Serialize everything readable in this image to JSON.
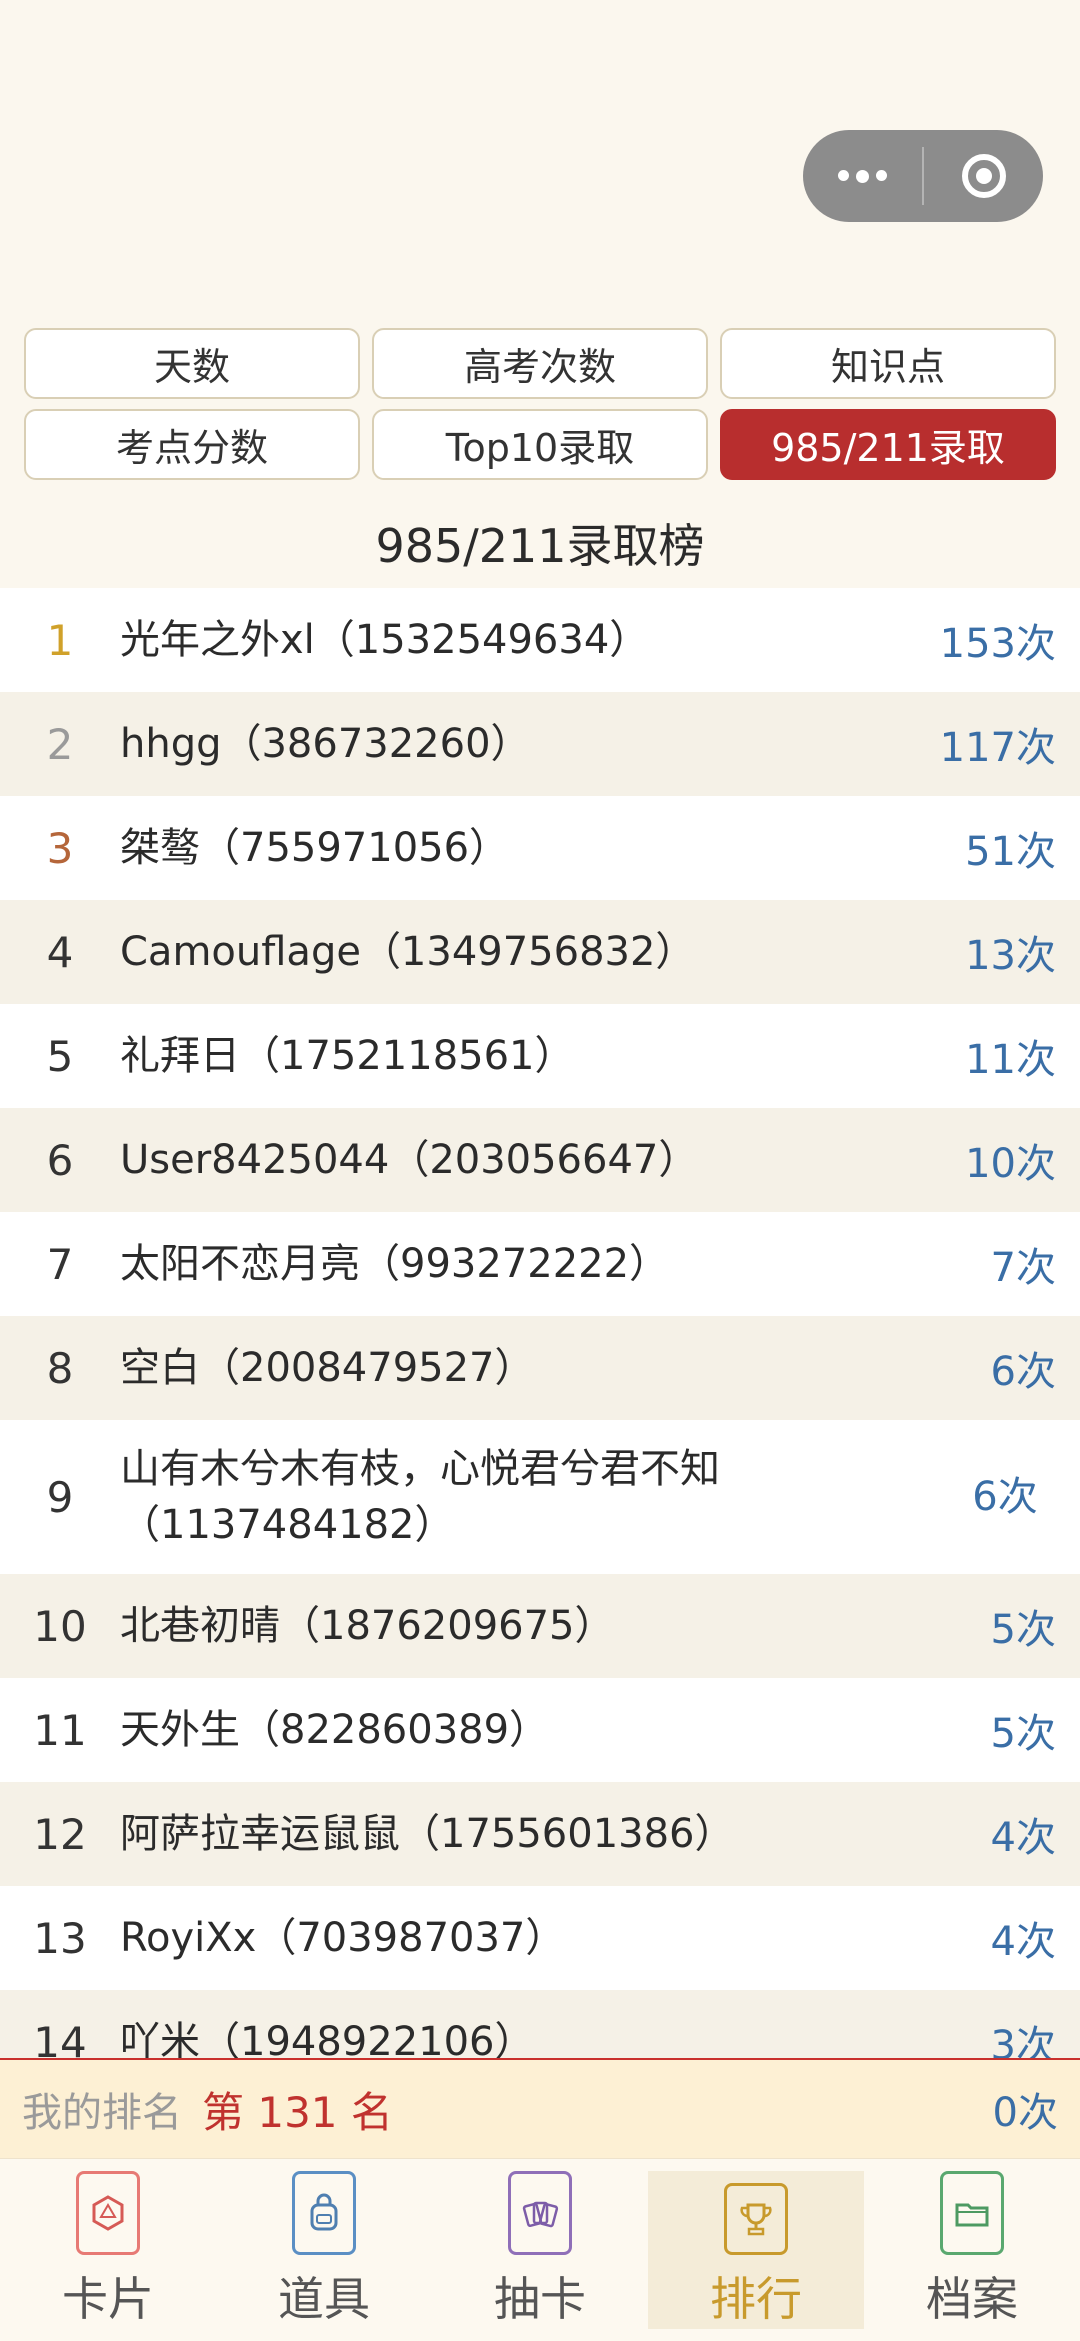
{
  "tabs": [
    {
      "label": "天数"
    },
    {
      "label": "高考次数"
    },
    {
      "label": "知识点"
    },
    {
      "label": "考点分数"
    },
    {
      "label": "Top10录取"
    },
    {
      "label": "985/211录取"
    }
  ],
  "active_tab": "985/211录取",
  "board_title": "985/211录取榜",
  "rows": [
    {
      "rank": "1",
      "name": "光年之外xl（1532549634）",
      "count": "153次"
    },
    {
      "rank": "2",
      "name": "hhgg（386732260）",
      "count": "117次"
    },
    {
      "rank": "3",
      "name": "桀骜（755971056）",
      "count": "51次"
    },
    {
      "rank": "4",
      "name": "Camouflage（1349756832）",
      "count": "13次"
    },
    {
      "rank": "5",
      "name": "礼拜日（1752118561）",
      "count": "11次"
    },
    {
      "rank": "6",
      "name": "User8425044（203056647）",
      "count": "10次"
    },
    {
      "rank": "7",
      "name": "太阳不恋月亮（993272222）",
      "count": "7次"
    },
    {
      "rank": "8",
      "name": "空白（2008479527）",
      "count": "6次"
    },
    {
      "rank": "9",
      "name": "山有木兮木有枝，心悦君兮君不知（1137484182）",
      "count": "6次"
    },
    {
      "rank": "10",
      "name": "北巷初晴（1876209675）",
      "count": "5次"
    },
    {
      "rank": "11",
      "name": "天外生（822860389）",
      "count": "5次"
    },
    {
      "rank": "12",
      "name": "阿萨拉幸运鼠鼠（1755601386）",
      "count": "4次"
    },
    {
      "rank": "13",
      "name": "RoyiXx（703987037）",
      "count": "4次"
    },
    {
      "rank": "14",
      "name": "吖米（1948922106）",
      "count": "3次"
    }
  ],
  "my_rank": {
    "label": "我的排名",
    "value": "第 131 名",
    "count": "0次"
  },
  "nav": [
    {
      "label": "卡片",
      "icon": "card-icon",
      "color": "#d65a55"
    },
    {
      "label": "道具",
      "icon": "backpack-icon",
      "color": "#4f7fb0"
    },
    {
      "label": "抽卡",
      "icon": "draw-cards-icon",
      "color": "#7d5da8"
    },
    {
      "label": "排行",
      "icon": "trophy-icon",
      "color": "#c89a2c"
    },
    {
      "label": "档案",
      "icon": "folder-icon",
      "color": "#4d9a62"
    }
  ]
}
